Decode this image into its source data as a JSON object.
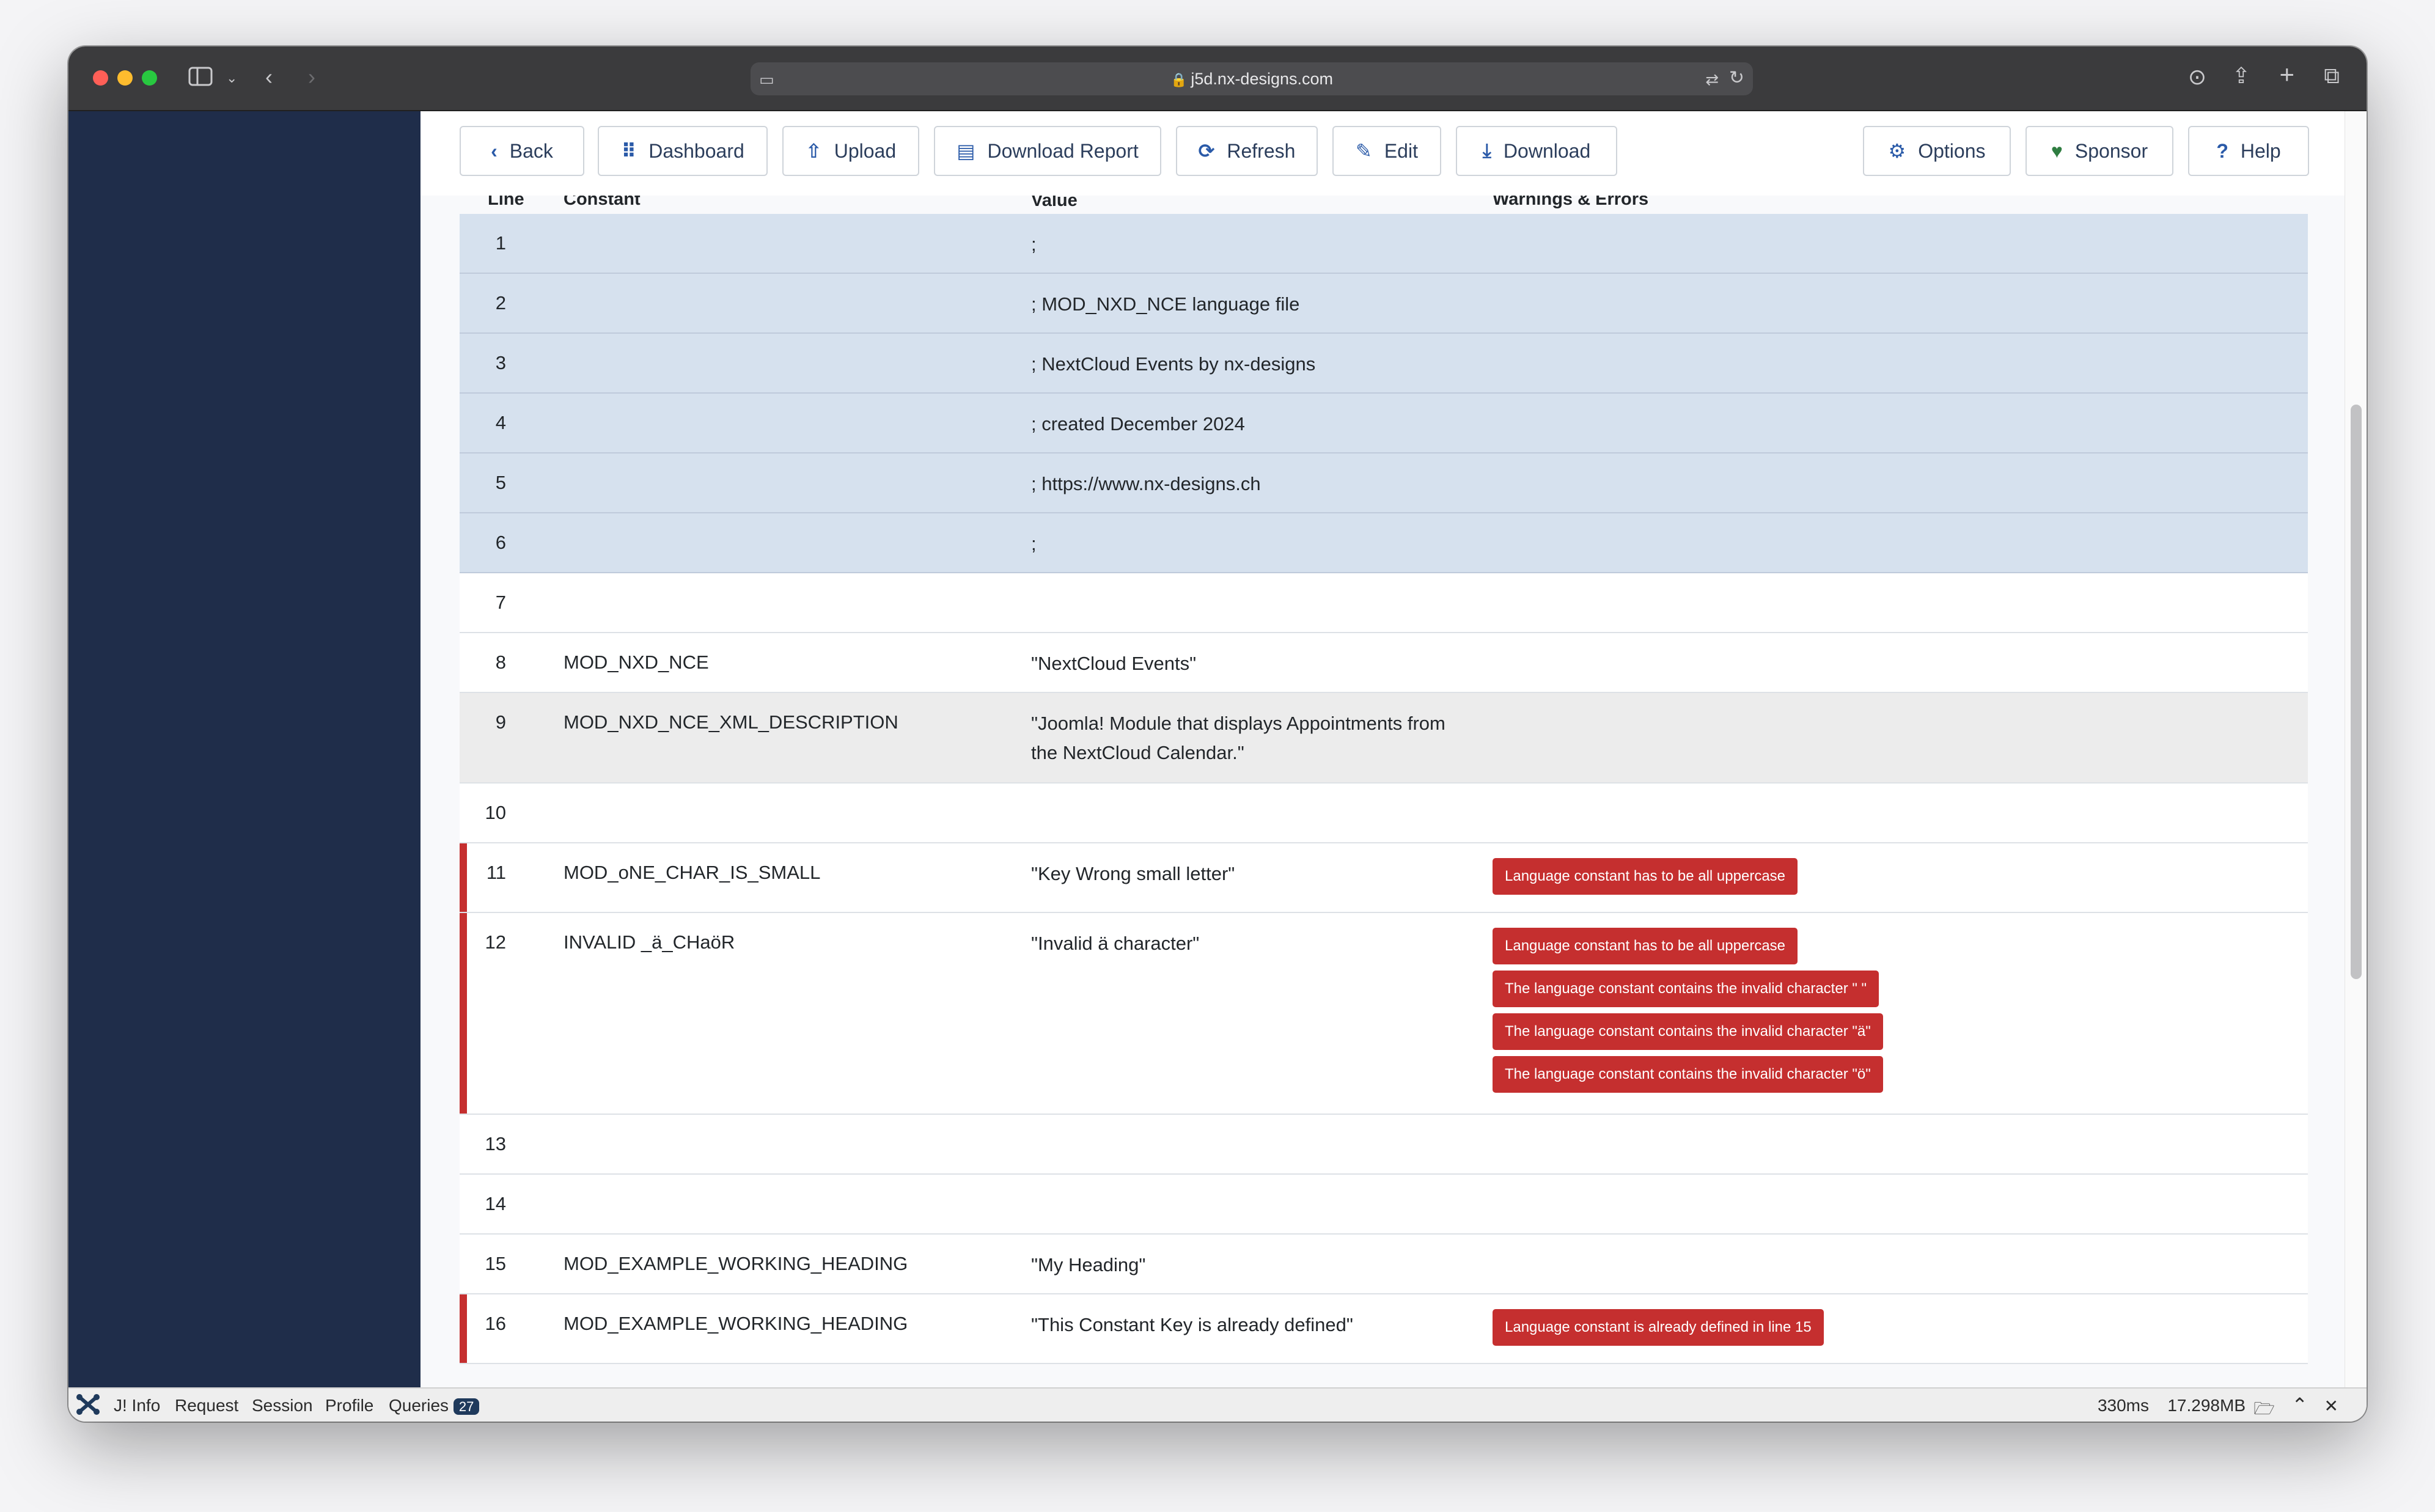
{
  "browser": {
    "url": "j5d.nx-designs.com"
  },
  "toolbar": {
    "back": "Back",
    "dashboard": "Dashboard",
    "upload": "Upload",
    "download_report": "Download Report",
    "refresh": "Refresh",
    "edit": "Edit",
    "download": "Download",
    "options": "Options",
    "sponsor": "Sponsor",
    "help": "Help"
  },
  "table": {
    "headers": [
      "Line",
      "Constant",
      "Value",
      "Warnings & Errors"
    ],
    "rows": [
      {
        "line": "1",
        "constant": "",
        "value": ";",
        "warnings": []
      },
      {
        "line": "2",
        "constant": "",
        "value": "; MOD_NXD_NCE language file",
        "warnings": []
      },
      {
        "line": "3",
        "constant": "",
        "value": "; NextCloud Events by nx-designs",
        "warnings": []
      },
      {
        "line": "4",
        "constant": "",
        "value": "; created December 2024",
        "warnings": []
      },
      {
        "line": "5",
        "constant": "",
        "value": "; https://www.nx-designs.ch",
        "warnings": []
      },
      {
        "line": "6",
        "constant": "",
        "value": ";",
        "warnings": []
      },
      {
        "line": "7",
        "constant": "",
        "value": "",
        "warnings": []
      },
      {
        "line": "8",
        "constant": "MOD_NXD_NCE",
        "value": "\"NextCloud Events\"",
        "warnings": []
      },
      {
        "line": "9",
        "constant": "MOD_NXD_NCE_XML_DESCRIPTION",
        "value": "\"Joomla! Module that displays Appointments from the NextCloud Calendar.\"",
        "warnings": []
      },
      {
        "line": "10",
        "constant": "",
        "value": "",
        "warnings": []
      },
      {
        "line": "11",
        "constant": "MOD_oNE_CHAR_IS_SMALL",
        "value": "\"Key Wrong small letter\"",
        "warnings": [
          "Language constant has to be all uppercase"
        ]
      },
      {
        "line": "12",
        "constant": "INVALID _ä_CHaöR",
        "value": "\"Invalid ä character\"",
        "warnings": [
          "Language constant has to be all uppercase",
          "The language constant contains the invalid character \" \"",
          "The language constant contains the invalid character \"ä\"",
          "The language constant contains the invalid character \"ö\""
        ]
      },
      {
        "line": "13",
        "constant": "",
        "value": "",
        "warnings": []
      },
      {
        "line": "14",
        "constant": "",
        "value": "",
        "warnings": []
      },
      {
        "line": "15",
        "constant": "MOD_EXAMPLE_WORKING_HEADING",
        "value": "\"My Heading\"",
        "warnings": []
      },
      {
        "line": "16",
        "constant": "MOD_EXAMPLE_WORKING_HEADING",
        "value": "\"This Constant Key is already defined\"",
        "warnings": [
          "Language constant is already defined in line 15"
        ]
      }
    ]
  },
  "debugbar": {
    "info": "J! Info",
    "request": "Request",
    "session": "Session",
    "profile": "Profile",
    "queries": "Queries",
    "queries_count": "27",
    "time": "330ms",
    "memory": "17.298MB"
  }
}
